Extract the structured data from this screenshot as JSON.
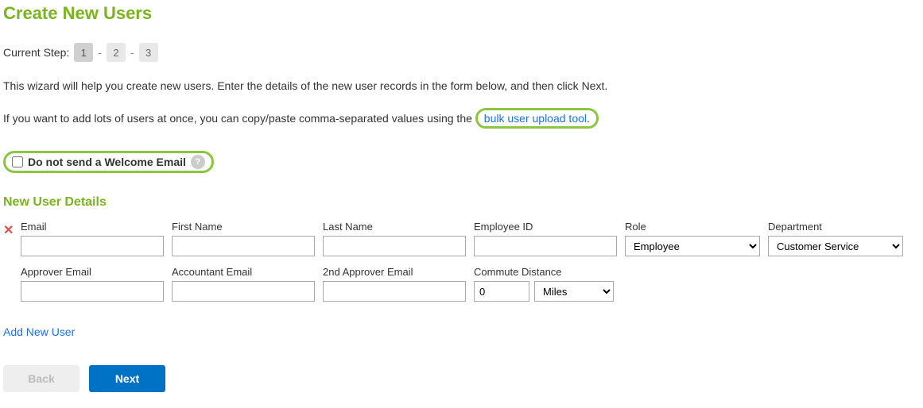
{
  "page": {
    "title": "Create New Users",
    "current_step_label": "Current Step:",
    "steps": [
      "1",
      "2",
      "3"
    ],
    "active_step_index": 0,
    "intro": "This wizard will help you create new users. Enter the details of the new user records in the form below, and then click Next.",
    "link_row_prefix": "If you want to add lots of users at once, you can copy/paste comma-separated values using the ",
    "link_text": "bulk user upload tool",
    "link_row_suffix": "."
  },
  "welcome_email": {
    "label": "Do not send a Welcome Email",
    "help_glyph": "?"
  },
  "section": {
    "title": "New User Details"
  },
  "labels": {
    "email": "Email",
    "first_name": "First Name",
    "last_name": "Last Name",
    "employee_id": "Employee ID",
    "role": "Role",
    "department": "Department",
    "approver_email": "Approver Email",
    "accountant_email": "Accountant Email",
    "second_approver_email": "2nd Approver Email",
    "commute_distance": "Commute Distance"
  },
  "values": {
    "email": "",
    "first_name": "",
    "last_name": "",
    "employee_id": "",
    "role": "Employee",
    "department": "Customer Service",
    "approver_email": "",
    "accountant_email": "",
    "second_approver_email": "",
    "commute_distance": "0",
    "commute_unit": "Miles"
  },
  "actions": {
    "add_new_user": "Add New User",
    "back": "Back",
    "next": "Next"
  }
}
